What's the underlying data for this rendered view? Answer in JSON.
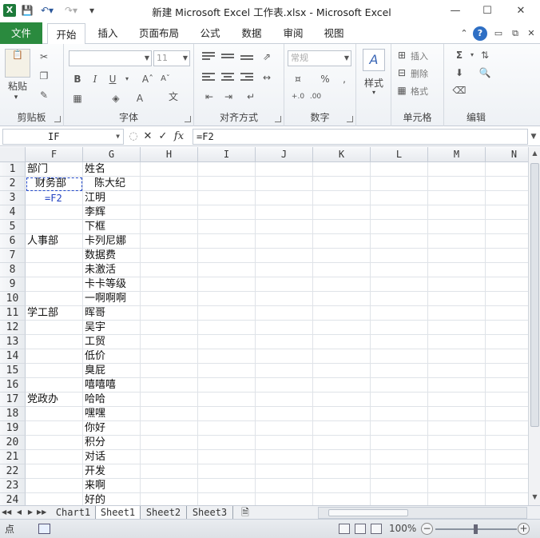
{
  "window": {
    "title": "新建 Microsoft Excel 工作表.xlsx - Microsoft Excel",
    "app_icon": "X"
  },
  "ribbon_tabs": {
    "file": "文件",
    "tabs": [
      "开始",
      "插入",
      "页面布局",
      "公式",
      "数据",
      "审阅",
      "视图"
    ],
    "active": "开始"
  },
  "ribbon": {
    "clipboard": {
      "label": "剪贴板",
      "paste": "粘贴"
    },
    "font": {
      "label": "字体",
      "size": "11",
      "bold": "B",
      "italic": "I",
      "underline": "U"
    },
    "alignment": {
      "label": "对齐方式"
    },
    "number": {
      "label": "数字",
      "format": "常规"
    },
    "styles": {
      "label": "样式"
    },
    "cells": {
      "label": "单元格",
      "insert": "插入",
      "delete": "删除",
      "format": "格式"
    },
    "editing": {
      "label": "编辑"
    }
  },
  "formula_bar": {
    "name_box": "IF",
    "formula": "=F2",
    "fx": "fx"
  },
  "columns": [
    "F",
    "G",
    "H",
    "I",
    "J",
    "K",
    "L",
    "M",
    "N"
  ],
  "rows": [
    "1",
    "2",
    "3",
    "4",
    "5",
    "6",
    "7",
    "8",
    "9",
    "10",
    "11",
    "12",
    "13",
    "14",
    "15",
    "16",
    "17",
    "18",
    "19",
    "20",
    "21",
    "22",
    "23",
    "24"
  ],
  "cells": {
    "F1": "部门",
    "G1": "姓名",
    "F2": "财务部",
    "G2": "陈大纪",
    "F3": "=F2",
    "G3": "江明",
    "G4": "李辉",
    "G5": "下框",
    "F6": "人事部",
    "G6": "卡列尼娜",
    "G7": "数据费",
    "G8": "未激活",
    "G9": "卡卡等级",
    "G10": "一啊啊啊",
    "F11": "学工部",
    "G11": "晖哥",
    "G12": "吴宇",
    "G13": "工贸",
    "G14": "低价",
    "G15": "臭屁",
    "G16": "嘻嘻嘻",
    "F17": "党政办",
    "G17": "哈哈",
    "G18": "嘿嘿",
    "G19": "你好",
    "G20": "积分",
    "G21": "对话",
    "G22": "开发",
    "G23": "来啊",
    "G24": "好的"
  },
  "sheets": [
    "Chart1",
    "Sheet1",
    "Sheet2",
    "Sheet3"
  ],
  "active_sheet": "Sheet1",
  "status": {
    "mode": "点",
    "zoom": "100%"
  },
  "colors": {
    "file_tab": "#2a8a3e",
    "reference": "#1f3fc0"
  }
}
